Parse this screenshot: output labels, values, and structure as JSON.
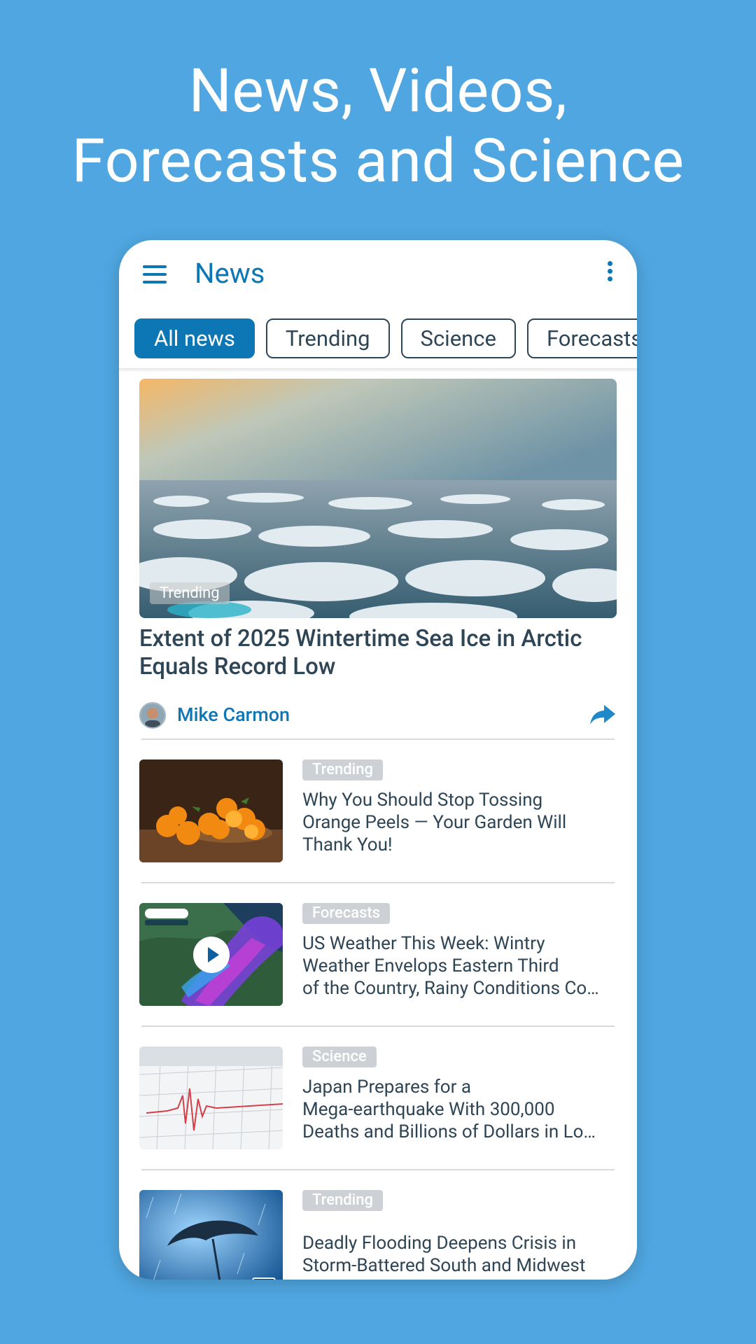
{
  "promo": {
    "line1": "News, Videos,",
    "line2": "Forecasts and Science"
  },
  "appbar": {
    "title": "News",
    "menu_icon": "hamburger-menu-icon",
    "overflow_icon": "more-vertical-icon"
  },
  "tabs": [
    {
      "label": "All news",
      "active": true
    },
    {
      "label": "Trending",
      "active": false
    },
    {
      "label": "Science",
      "active": false
    },
    {
      "label": "Forecasts",
      "active": false
    }
  ],
  "hero": {
    "badge": "Trending",
    "title": "Extent of 2025 Wintertime Sea Ice in Arctic Equals Record Low",
    "author": "Mike Carmon",
    "share_icon": "share-arrow-icon"
  },
  "articles": [
    {
      "badge": "Trending",
      "lines": [
        "Why You Should Stop Tossing",
        "Orange Peels — Your Garden Will",
        "Thank You!"
      ]
    },
    {
      "badge": "Forecasts",
      "thumb_brand": "METEORED",
      "lines": [
        "US Weather This Week: Wintry",
        "Weather Envelops Eastern Third",
        "of the Country, Rainy Conditions Co…"
      ]
    },
    {
      "badge": "Science",
      "thumb_label": "SEISMOGRAPH",
      "lines": [
        "Japan Prepares for a",
        "Mega-earthquake With 300,000",
        "Deaths and Billions of Dollars in Lo…"
      ]
    },
    {
      "badge": "Trending",
      "lines": [
        "Deadly Flooding Deepens Crisis in",
        "Storm-Battered South and Midwest"
      ]
    }
  ],
  "colors": {
    "background": "#4FA6E0",
    "accent": "#0D77B5",
    "text": "#2E4556"
  }
}
